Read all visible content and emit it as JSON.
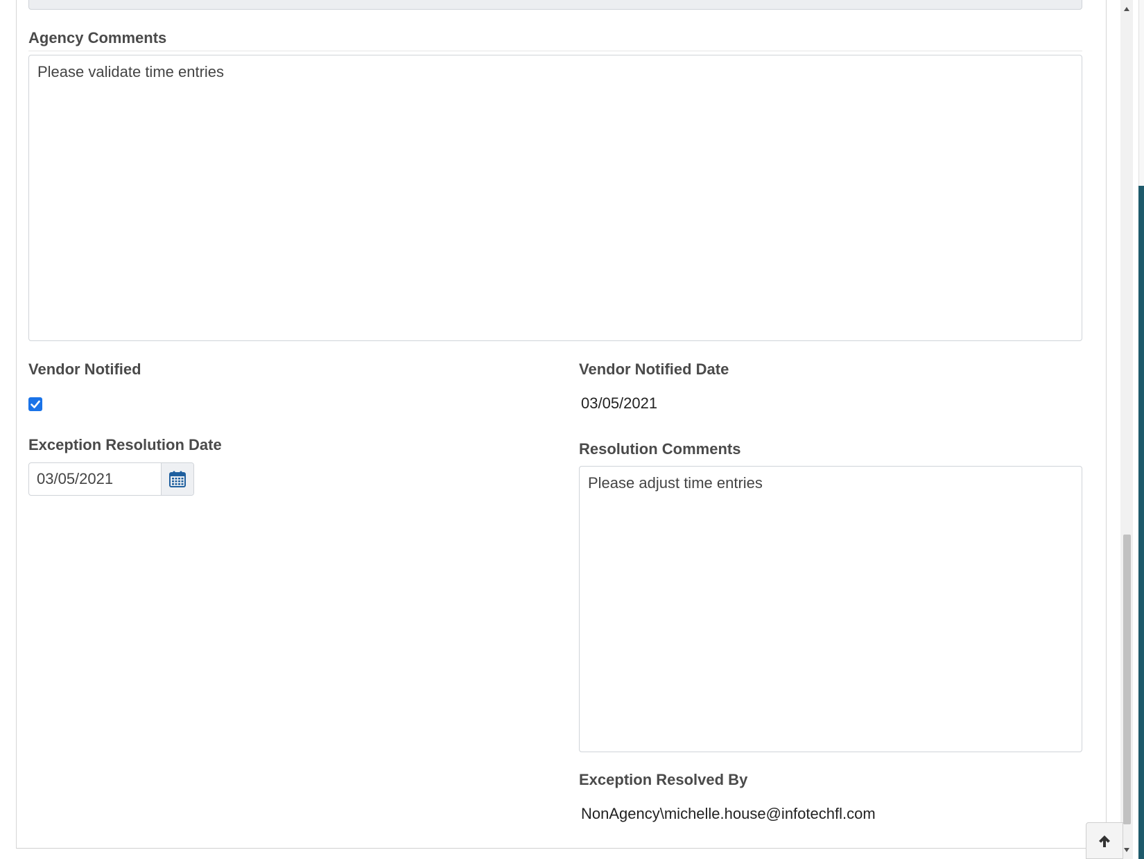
{
  "agency_comments": {
    "label": "Agency Comments",
    "value": "Please validate time entries"
  },
  "vendor_notified": {
    "label": "Vendor Notified",
    "checked": true
  },
  "vendor_notified_date": {
    "label": "Vendor Notified Date",
    "value": "03/05/2021"
  },
  "exception_resolution_date": {
    "label": "Exception Resolution Date",
    "value": "03/05/2021",
    "icon": "calendar-icon"
  },
  "resolution_comments": {
    "label": "Resolution Comments",
    "value": "Please adjust time entries"
  },
  "exception_resolved_by": {
    "label": "Exception Resolved By",
    "value": "NonAgency\\michelle.house@infotechfl.com"
  },
  "scroll_top_button": {
    "icon": "arrow-up-icon"
  },
  "colors": {
    "accent": "#1a73e8",
    "calendar_icon": "#1f5f9e",
    "sidebar_edge": "#1e5a6b"
  }
}
